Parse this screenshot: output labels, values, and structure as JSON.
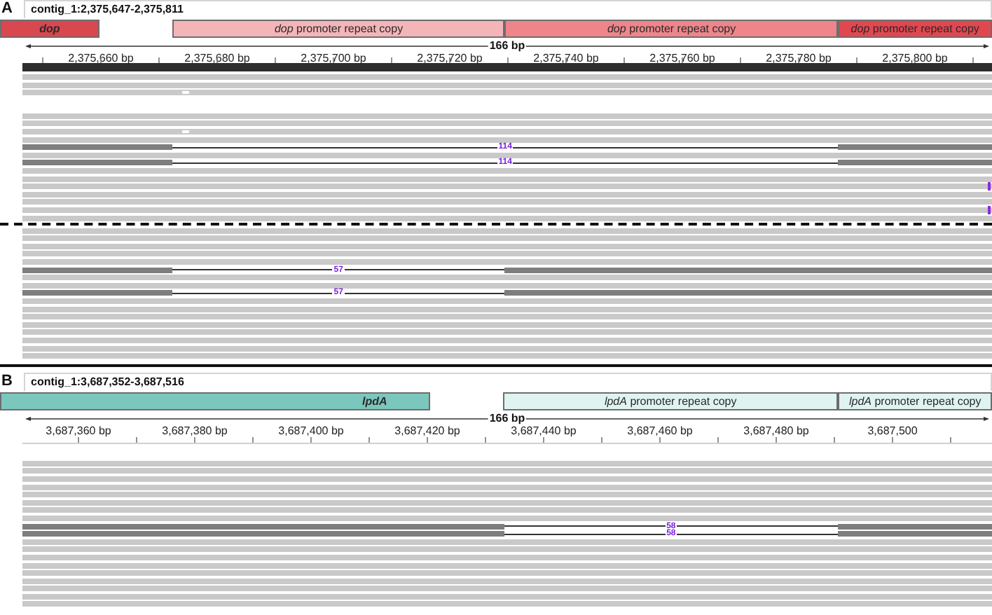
{
  "panels": [
    {
      "letter": "A",
      "locus": "contig_1:2,375,647-2,375,811",
      "span": "166 bp",
      "features": [
        {
          "label": "dop",
          "kind": "gene",
          "color": "#d9474f"
        },
        {
          "label": "*dop* promoter repeat copy",
          "kind": "repeat",
          "color": "#f4b5b9"
        },
        {
          "label": "*dop* promoter repeat copy",
          "kind": "repeat",
          "color": "#ee858b"
        },
        {
          "label": "*dop* promoter repeat copy",
          "kind": "repeat",
          "color": "#e2474f"
        }
      ],
      "ticks": [
        "2,375,660 bp",
        "2,375,680 bp",
        "2,375,700 bp",
        "2,375,720 bp",
        "2,375,740 bp",
        "2,375,760 bp",
        "2,375,780 bp",
        "2,375,800 bp"
      ],
      "deletions": [
        {
          "label": "114"
        },
        {
          "label": "114"
        },
        {
          "label": "57"
        },
        {
          "label": "57"
        }
      ]
    },
    {
      "letter": "B",
      "locus": "contig_1:3,687,352-3,687,516",
      "span": "166 bp",
      "features": [
        {
          "label": "lpdA",
          "kind": "gene",
          "color": "#7cc7bd"
        },
        {
          "label": "*lpdA* promoter repeat copy",
          "kind": "repeat",
          "color": "#dff4f1"
        },
        {
          "label": "*lpdA* promoter repeat copy",
          "kind": "repeat",
          "color": "#dff4f1"
        }
      ],
      "ticks": [
        "3,687,360 bp",
        "3,687,380 bp",
        "3,687,400 bp",
        "3,687,420 bp",
        "3,687,440 bp",
        "3,687,460 bp",
        "3,687,480 bp",
        "3,687,500"
      ],
      "deletions": [
        {
          "label": "58"
        },
        {
          "label": "58"
        }
      ]
    }
  ]
}
